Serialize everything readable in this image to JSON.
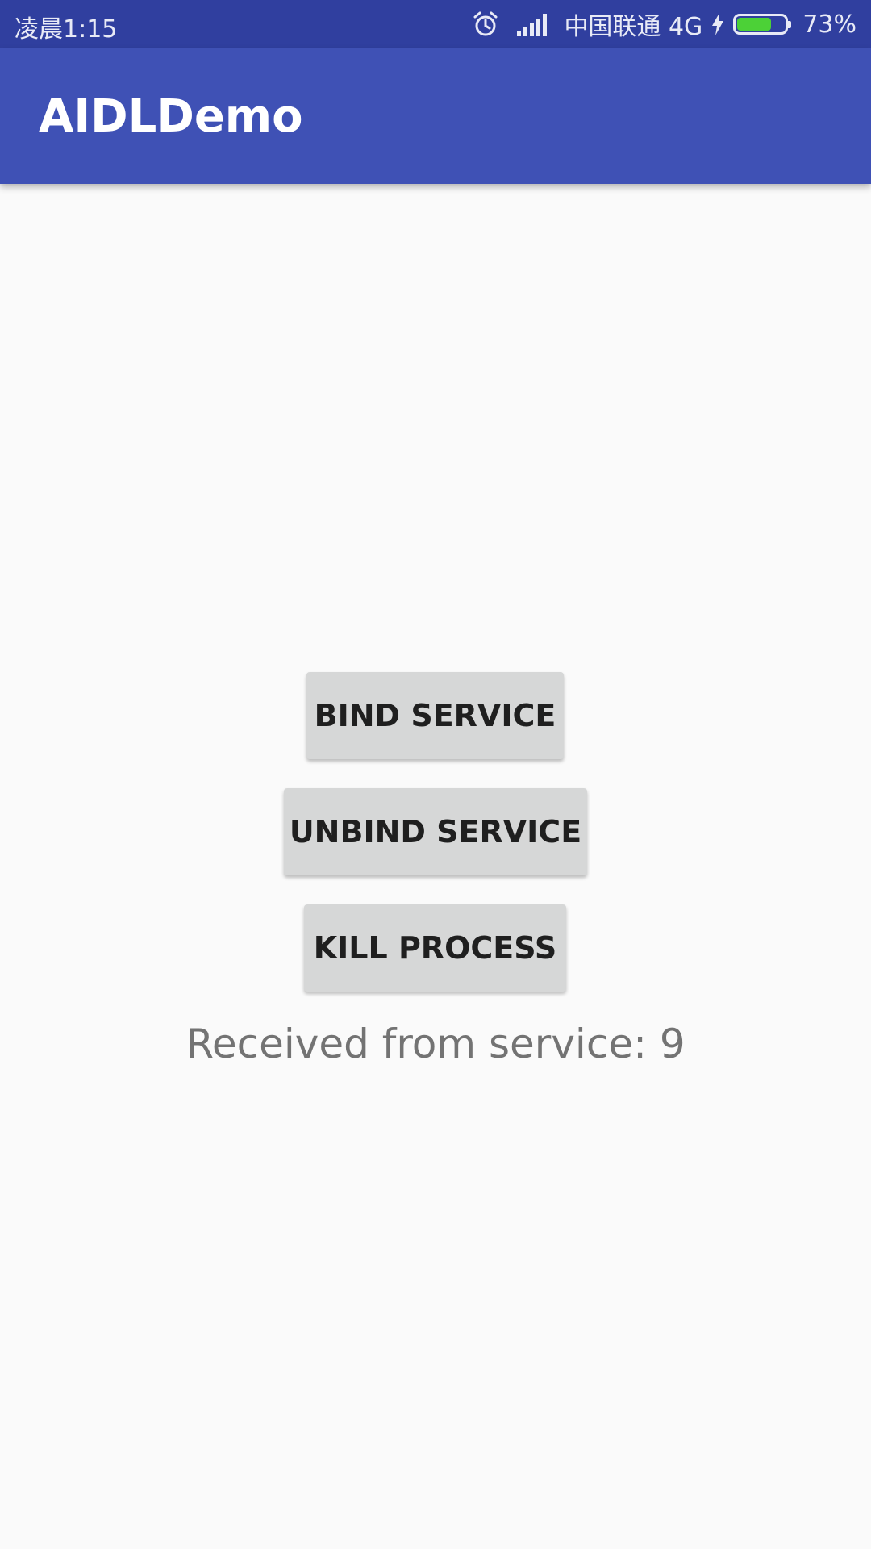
{
  "status_bar": {
    "time": "凌晨1:15",
    "carrier": "中国联通 4G",
    "battery_percent": "73%",
    "battery_level": 0.73,
    "icons": [
      "alarm-icon",
      "signal-icon",
      "charging-icon",
      "battery-icon"
    ]
  },
  "app_bar": {
    "title": "AIDLDemo",
    "color": "#3f51b5"
  },
  "main": {
    "bind_label": "BIND SERVICE",
    "unbind_label": "UNBIND SERVICE",
    "kill_label": "KILL PROCESS",
    "received_text": "Received from service: 9"
  },
  "colors": {
    "status_bar": "#303f9f",
    "app_bar": "#3f51b5",
    "button": "#d6d7d7",
    "battery_fill": "#4cd137"
  }
}
